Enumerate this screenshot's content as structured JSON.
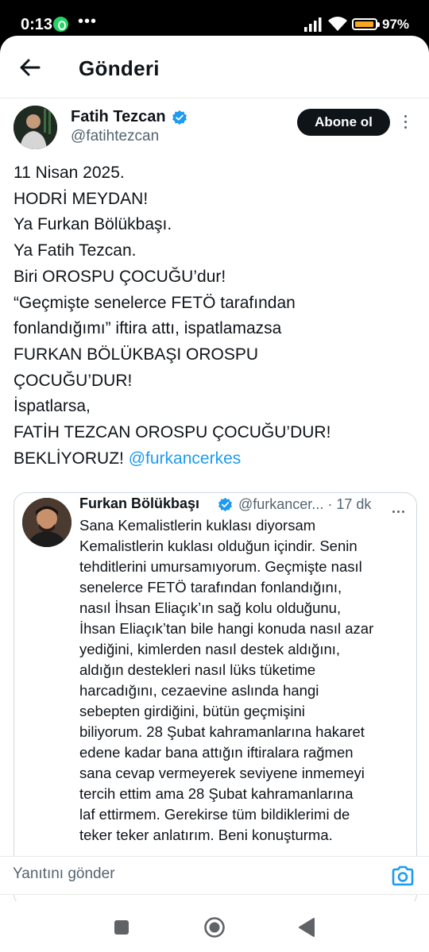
{
  "status_bar": {
    "time": "0:13",
    "dots": "•••",
    "battery_percent": "97%",
    "battery_level": 0.97,
    "battery_color": "#f5a623"
  },
  "header": {
    "back_icon": "arrow-left-icon",
    "title": "Gönderi"
  },
  "tweet": {
    "author_name": "Fatih Tezcan",
    "author_handle": "@fatihtezcan",
    "verified_icon": "verified-badge-icon",
    "follow_label": "Abone ol",
    "more_icon": "more-vertical-icon",
    "lines": [
      "11 Nisan 2025.",
      "HODRİ MEYDAN!",
      "Ya Furkan Bölükbaşı.",
      "Ya Fatih Tezcan.",
      "Biri OROSPU ÇOCUĞU’dur!",
      "“Geçmişte senelerce FETÖ tarafından",
      "fonlandığımı” iftira attı, ispatlamazsa",
      "FURKAN BÖLÜKBAŞI OROSPU",
      "ÇOCUĞU’DUR!",
      "İspatlarsa,",
      "FATİH TEZCAN OROSPU ÇOCUĞU’DUR!"
    ],
    "last_line_text": "BEKLİYORUZ!",
    "mention": "@furkancerkes"
  },
  "quoted_tweet": {
    "author_name": "Furkan Bölükbaşı",
    "author_handle": "@furkancer...",
    "time": "· 17 dk",
    "lines": [
      "Sana Kemalistlerin kuklası diyorsam",
      "Kemalistlerin kuklası olduğun içindir. Senin",
      "tehditlerini umursamıyorum. Geçmişte nasıl",
      "senelerce FETÖ tarafından fonlandığını,",
      "nasıl İhsan Eliaçık’ın sağ kolu olduğunu,",
      "İhsan Eliaçık’tan bile hangi konuda nasıl azar",
      "yediğini, kimlerden nasıl destek aldığını,",
      "aldığın destekleri nasıl lüks tüketime",
      "harcadığını, cezaevine aslında hangi",
      "sebepten girdiğini, bütün geçmişini",
      "biliyorum. 28 Şubat kahramanlarına hakaret",
      "edene kadar bana attığın iftiralara rağmen",
      "sana cevap vermeyerek seviyene inmemeyi",
      "tercih ettim ama 28 Şubat kahramanlarına",
      "laf ettirmem. Gerekirse tüm bildiklerimi de",
      "teker teker anlatırım. Beni konuşturma."
    ]
  },
  "reply": {
    "placeholder": "Yanıtını gönder",
    "camera_icon": "camera-icon"
  },
  "navbar": {
    "recents_icon": "square-recents-icon",
    "home_icon": "circle-home-icon",
    "back_icon": "triangle-back-icon"
  },
  "colors": {
    "accent": "#1d9bf0",
    "text": "#0f1419",
    "secondary": "#536471",
    "follow_bg": "#0f1419"
  }
}
